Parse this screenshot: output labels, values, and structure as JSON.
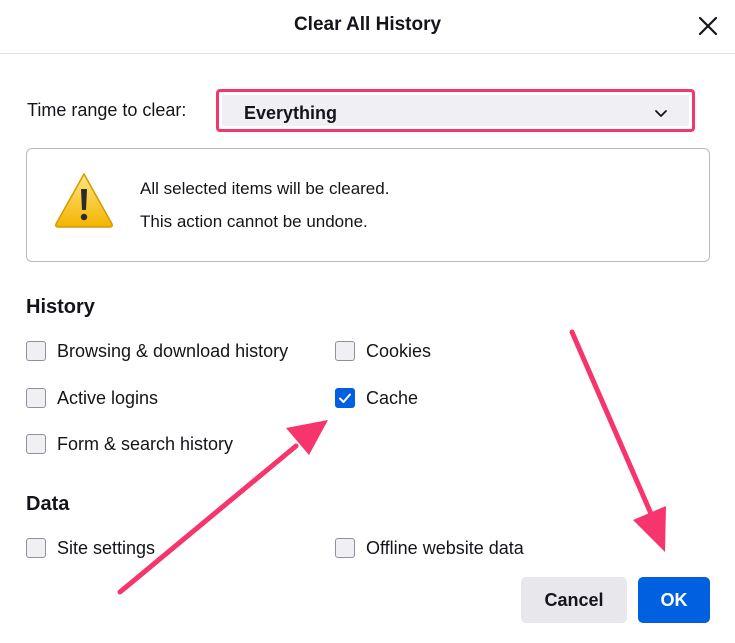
{
  "dialog": {
    "title": "Clear All History"
  },
  "time_range": {
    "label": "Time range to clear:",
    "selected": "Everything"
  },
  "warning": {
    "line1": "All selected items will be cleared.",
    "line2": "This action cannot be undone."
  },
  "history": {
    "title": "History",
    "items": [
      {
        "label": "Browsing & download history",
        "checked": false
      },
      {
        "label": "Cookies",
        "checked": false
      },
      {
        "label": "Active logins",
        "checked": false
      },
      {
        "label": "Cache",
        "checked": true
      },
      {
        "label": "Form & search history",
        "checked": false
      }
    ]
  },
  "data_section": {
    "title": "Data",
    "items": [
      {
        "label": "Site settings",
        "checked": false
      },
      {
        "label": "Offline website data",
        "checked": false
      }
    ]
  },
  "buttons": {
    "cancel": "Cancel",
    "ok": "OK"
  },
  "colors": {
    "highlight": "#f0386b",
    "accent": "#0061e0",
    "annotation_arrow": "#f6356f"
  },
  "icons": {
    "close": "close-icon",
    "dropdown": "chevron-down-icon",
    "warning": "warning-icon",
    "check": "checkmark-icon"
  }
}
